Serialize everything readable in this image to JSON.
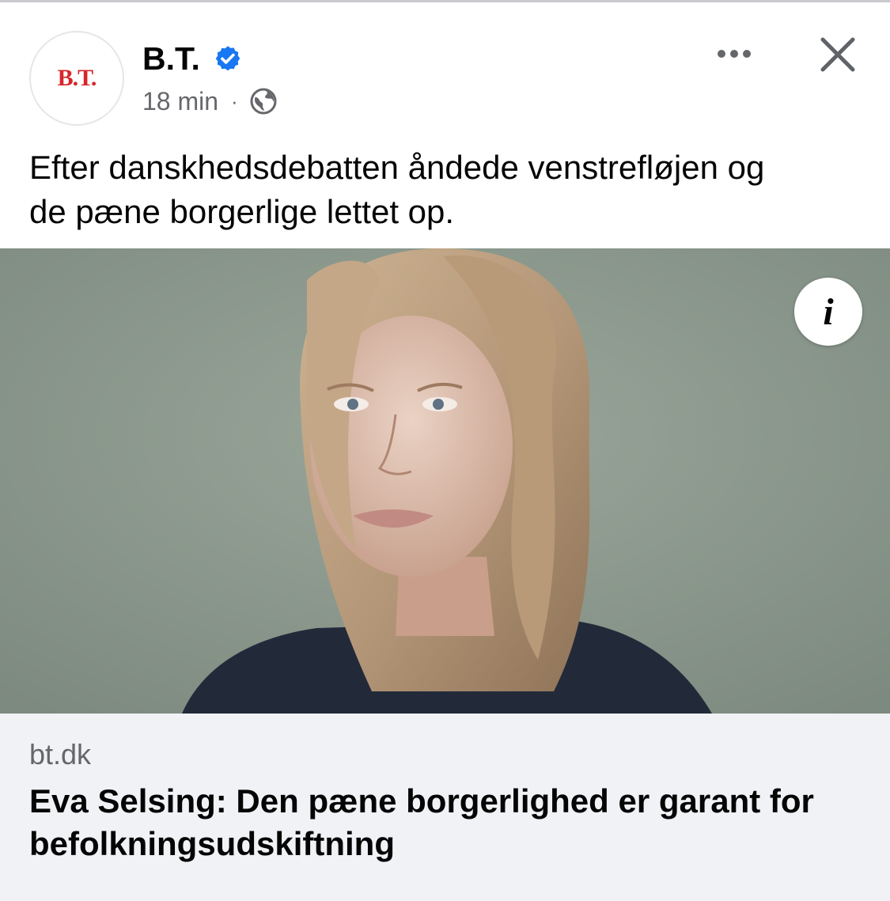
{
  "post": {
    "page_name": "B.T.",
    "avatar_logo_text": "B.T.",
    "timestamp": "18 min",
    "separator": "·",
    "audience_icon": "globe-icon",
    "verified_icon": "verified-badge-icon",
    "more_icon": "more-dots-icon",
    "close_icon": "close-icon",
    "text_line1": "Efter danskhedsdebatten åndede venstrefløjen og",
    "text_line2": "de pæne borgerlige lettet op."
  },
  "link_preview": {
    "info_icon": "info-icon",
    "info_glyph": "i",
    "domain": "bt.dk",
    "title_line1": "Eva Selsing: Den pæne borgerlighed er garant for",
    "title_line2": "befolkningsudskiftning"
  },
  "colors": {
    "verified_blue": "#1877f2",
    "brand_red": "#d7262a",
    "meta_gray": "#65676b",
    "link_box_bg": "#f0f2f5",
    "photo_background": "#8d9a8e"
  }
}
